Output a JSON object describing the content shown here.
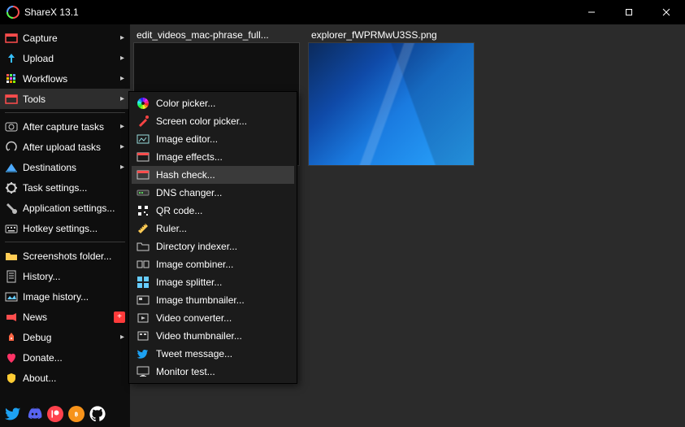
{
  "app": {
    "title": "ShareX 13.1"
  },
  "sidebar": {
    "items": [
      {
        "label": "Capture",
        "arrow": true
      },
      {
        "label": "Upload",
        "arrow": true
      },
      {
        "label": "Workflows",
        "arrow": true
      },
      {
        "label": "Tools",
        "arrow": true,
        "selected": true
      },
      {
        "sep": true
      },
      {
        "label": "After capture tasks",
        "arrow": true
      },
      {
        "label": "After upload tasks",
        "arrow": true
      },
      {
        "label": "Destinations",
        "arrow": true
      },
      {
        "label": "Task settings..."
      },
      {
        "label": "Application settings..."
      },
      {
        "label": "Hotkey settings..."
      },
      {
        "sep": true
      },
      {
        "label": "Screenshots folder..."
      },
      {
        "label": "History..."
      },
      {
        "label": "Image history..."
      },
      {
        "label": "News",
        "badge": "+"
      },
      {
        "label": "Debug",
        "arrow": true
      },
      {
        "label": "Donate..."
      },
      {
        "label": "About..."
      }
    ]
  },
  "tools_submenu": {
    "items": [
      {
        "label": "Color picker..."
      },
      {
        "label": "Screen color picker..."
      },
      {
        "label": "Image editor..."
      },
      {
        "label": "Image effects..."
      },
      {
        "label": "Hash check...",
        "hovered": true
      },
      {
        "label": "DNS changer..."
      },
      {
        "label": "QR code..."
      },
      {
        "label": "Ruler..."
      },
      {
        "label": "Directory indexer..."
      },
      {
        "label": "Image combiner..."
      },
      {
        "label": "Image splitter..."
      },
      {
        "label": "Image thumbnailer..."
      },
      {
        "label": "Video converter..."
      },
      {
        "label": "Video thumbnailer..."
      },
      {
        "label": "Tweet message..."
      },
      {
        "label": "Monitor test..."
      }
    ]
  },
  "thumbnails": [
    {
      "name": "edit_videos_mac-phrase_full...",
      "kind": "black"
    },
    {
      "name": "explorer_fWPRMwU3SS.png",
      "kind": "image"
    }
  ]
}
